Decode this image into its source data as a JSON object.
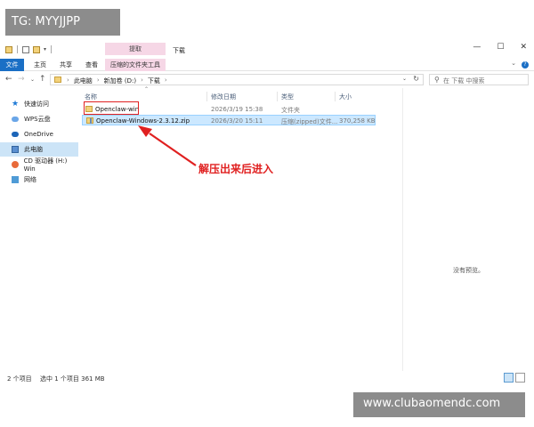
{
  "overlay": {
    "tg_label": "TG: MYYJJPP",
    "watermark": "www.clubaomendc.com",
    "annotation": "解压出来后进入",
    "annotation_color": "#e02020"
  },
  "window": {
    "title": "下载",
    "context_tab_group": "提取",
    "controls": [
      "—",
      "☐",
      "✕"
    ]
  },
  "ribbon": {
    "tabs": [
      "文件",
      "主页",
      "共享",
      "查看",
      "压缩的文件夹工具"
    ],
    "accent": "#1a6fc5",
    "context_color": "#f6d7e6"
  },
  "address": {
    "crumbs": [
      "此电脑",
      "新加卷 (D:)",
      "下载"
    ],
    "search_placeholder": "在 下载 中搜索"
  },
  "sidebar": {
    "items": [
      {
        "label": "快速访问",
        "icon": "star-icon",
        "selected": false
      },
      {
        "label": "WPS云盘",
        "icon": "cloud-icon",
        "selected": false
      },
      {
        "label": "OneDrive",
        "icon": "onedrive-icon",
        "selected": false
      },
      {
        "label": "此电脑",
        "icon": "computer-icon",
        "selected": true
      },
      {
        "label": "CD 驱动器 (H:) Win",
        "icon": "cd-drive-icon",
        "selected": false
      },
      {
        "label": "网络",
        "icon": "network-icon",
        "selected": false
      }
    ]
  },
  "columns": [
    "名称",
    "修改日期",
    "类型",
    "大小"
  ],
  "files": [
    {
      "name": "Openclaw-win",
      "date": "2026/3/19 15:38",
      "type": "文件夹",
      "size": "",
      "icon": "folder-icon",
      "selected": false
    },
    {
      "name": "Openclaw-Windows-2.3.12.zip",
      "date": "2026/3/20 15:11",
      "type": "压缩(zipped)文件...",
      "size": "370,258 KB",
      "icon": "zip-folder-icon",
      "selected": true
    }
  ],
  "preview": {
    "empty_text": "没有预览。"
  },
  "status": {
    "item_count": "2 个项目",
    "selection": "选中 1 个项目  361 MB"
  }
}
